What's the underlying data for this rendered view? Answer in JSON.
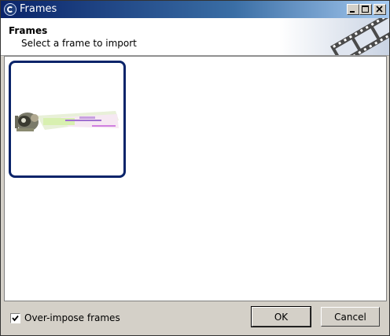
{
  "window": {
    "title": "Frames",
    "icon": "eclipse-app-icon",
    "controls": {
      "minimize": "minimize-icon",
      "maximize": "maximize-icon",
      "close": "close-icon"
    }
  },
  "header": {
    "title": "Frames",
    "description": "Select a frame to import",
    "banner_icon": "film-strip-icon"
  },
  "frames": [
    {
      "selected": true,
      "thumbnail": "frame-thumbnail"
    }
  ],
  "footer": {
    "overimpose_label": "Over-impose frames",
    "overimpose_checked": true,
    "ok_label": "OK",
    "cancel_label": "Cancel"
  },
  "colors": {
    "titlebar_start": "#0a246a",
    "titlebar_end": "#a6caf0",
    "selection_border": "#0a246a",
    "dialog_bg": "#d4d0c8"
  }
}
